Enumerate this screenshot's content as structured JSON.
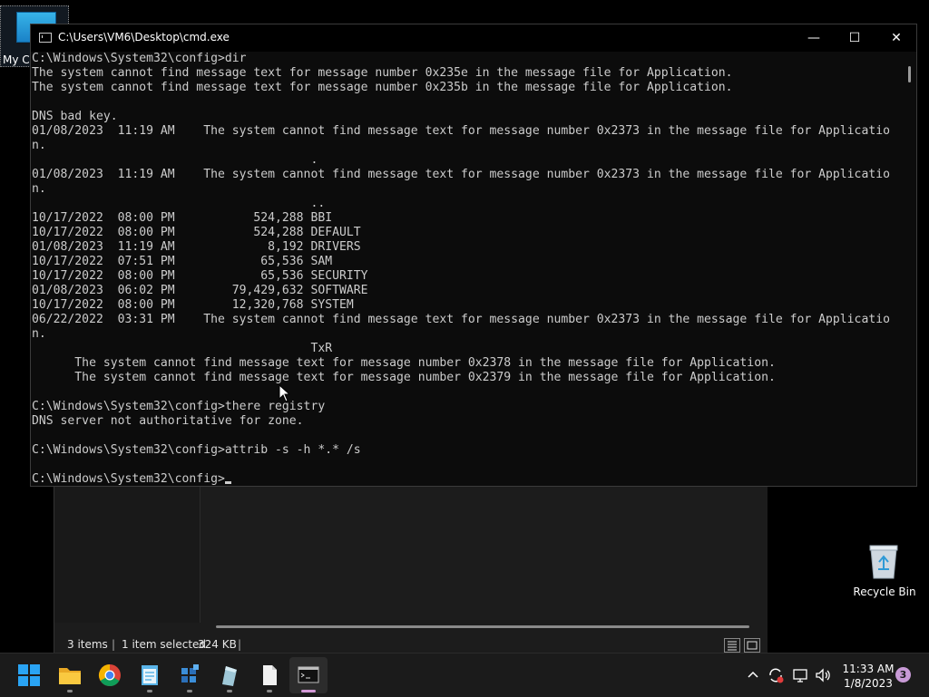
{
  "desktop": {
    "my_pc_label": "My Co",
    "recycle_bin_label": "Recycle Bin"
  },
  "cmd": {
    "title": "C:\\Users\\VM6\\Desktop\\cmd.exe",
    "minimize_glyph": "—",
    "maximize_glyph": "☐",
    "close_glyph": "✕",
    "lines": [
      "C:\\Windows\\System32\\config>dir",
      "The system cannot find message text for message number 0x235e in the message file for Application.",
      "The system cannot find message text for message number 0x235b in the message file for Application.",
      "",
      "DNS bad key.",
      "01/08/2023  11:19 AM    The system cannot find message text for message number 0x2373 in the message file for Applicatio",
      "n.",
      "                                       .",
      "01/08/2023  11:19 AM    The system cannot find message text for message number 0x2373 in the message file for Applicatio",
      "n.",
      "                                       ..",
      "10/17/2022  08:00 PM           524,288 BBI",
      "10/17/2022  08:00 PM           524,288 DEFAULT",
      "01/08/2023  11:19 AM             8,192 DRIVERS",
      "10/17/2022  07:51 PM            65,536 SAM",
      "10/17/2022  08:00 PM            65,536 SECURITY",
      "01/08/2023  06:02 PM        79,429,632 SOFTWARE",
      "10/17/2022  08:00 PM        12,320,768 SYSTEM",
      "06/22/2022  03:31 PM    The system cannot find message text for message number 0x2373 in the message file for Applicatio",
      "n.",
      "                                       TxR",
      "      The system cannot find message text for message number 0x2378 in the message file for Application.",
      "      The system cannot find message text for message number 0x2379 in the message file for Application.",
      "",
      "C:\\Windows\\System32\\config>there registry",
      "DNS server not authoritative for zone.",
      "",
      "C:\\Windows\\System32\\config>attrib -s -h *.* /s",
      "",
      "C:\\Windows\\System32\\config>"
    ]
  },
  "explorer": {
    "item_count": "3 items",
    "selection": "1 item selected",
    "selection_size": "324 KB"
  },
  "taskbar": {
    "icons": [
      "windows-start",
      "file-explorer",
      "chrome",
      "notepad",
      "registry-editor",
      "paint",
      "blank-document",
      "command-prompt"
    ],
    "time": "11:33 AM",
    "date": "1/8/2023",
    "notification_count": "3"
  }
}
